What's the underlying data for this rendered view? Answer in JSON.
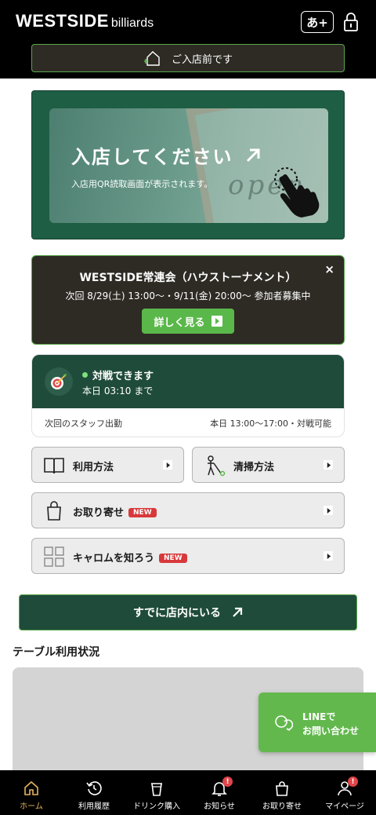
{
  "header": {
    "logo_main": "WESTSIDE",
    "logo_sub": "billiards",
    "lang_label": "あ+",
    "status_text": "ご入店前です"
  },
  "qr_banner": {
    "title": "入店してください",
    "subtitle": "入店用QR読取画面が表示されます。",
    "background_script": "open"
  },
  "tournament": {
    "title": "WESTSIDE常連会（ハウストーナメント）",
    "dates": "次回 8/29(土) 13:00〜・9/11(金) 20:00〜 参加者募集中",
    "button_label": "詳しく見る",
    "close_label": "×"
  },
  "battle": {
    "status": "対戦できます",
    "until": "本日 03:10 まで",
    "staff_label": "次回のスタッフ出勤",
    "staff_time": "本日 13:00〜17:00・対戦可能"
  },
  "menu": {
    "usage": "利用方法",
    "cleaning": "清掃方法",
    "order": "お取り寄せ",
    "carom": "キャロムを知ろう",
    "new_badge": "NEW"
  },
  "enter_button": "すでに店内にいる",
  "table_section_title": "テーブル利用状況",
  "line_fab": {
    "line1": "LINEで",
    "line2": "お問い合わせ"
  },
  "bottom_nav": [
    {
      "label": "ホーム",
      "icon": "home-icon",
      "active": true
    },
    {
      "label": "利用履歴",
      "icon": "history-icon"
    },
    {
      "label": "ドリンク購入",
      "icon": "cup-icon"
    },
    {
      "label": "お知らせ",
      "icon": "bell-icon",
      "badge": "!"
    },
    {
      "label": "お取り寄せ",
      "icon": "bag-icon"
    },
    {
      "label": "マイページ",
      "icon": "user-icon",
      "badge": "!"
    }
  ],
  "colors": {
    "header_bg": "#000000",
    "accent_green": "#5ab84a",
    "dark_green": "#1f4b3a",
    "active_nav": "#e6b35f",
    "badge_red": "#d8383a"
  }
}
